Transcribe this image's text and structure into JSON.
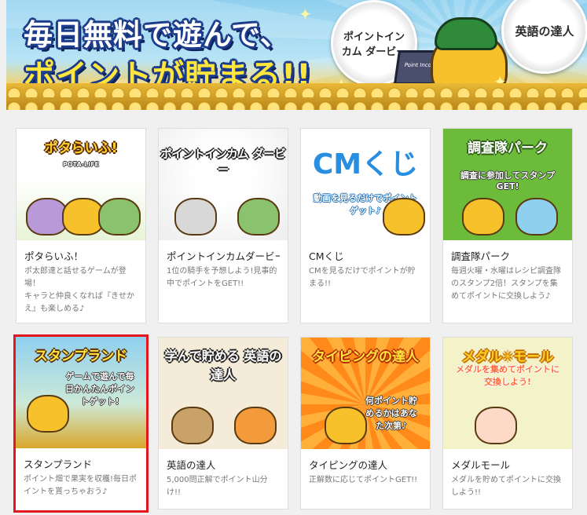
{
  "banner": {
    "headline_line1": "毎日無料で遊んで、",
    "headline_line2": "ポイントが貯まる!!",
    "medal_derby": "ポイントインカム ダービー",
    "medal_eigo": "英語の達人",
    "laptop_logo": "Point Income"
  },
  "games": [
    {
      "title": "ポタらいふ！",
      "thumb_title": "ポタらいふ!",
      "thumb_sub": "POTA-LIFE",
      "description": "ポ太郎達と話せるゲームが登場！\nキャラと仲良くなれば『きせかえ』も楽しめる♪"
    },
    {
      "title": "ポイントインカムダービー",
      "thumb_title": "ポイントインカム ダービー",
      "thumb_sub": "",
      "description": "1位の騎手を予想しよう!見事的中でポイントをGET!!"
    },
    {
      "title": "CMくじ",
      "thumb_title": "CMくじ",
      "thumb_sub": "動画を見るだけでポイントゲット♪",
      "description": "CMを見るだけでポイントが貯まる!!"
    },
    {
      "title": "調査隊パーク",
      "thumb_title": "調査隊パーク",
      "thumb_sub": "調査に参加してスタンプGET!",
      "description": "毎週火曜・水曜はレシピ調査隊のスタンプ2倍！スタンプを集めてポイントに交換しよう♪"
    },
    {
      "title": "スタンプランド",
      "thumb_title": "スタンプランド",
      "thumb_sub": "ゲームで遊んで毎日かんたんポイントゲット!",
      "description": "ポイント畑で果実を収穫!毎日ポイントを貰っちゃおう♪"
    },
    {
      "title": "英語の達人",
      "thumb_title": "学んで貯める 英語の達人",
      "thumb_sub": "",
      "description": "5,000問正解でポイント山分け!!"
    },
    {
      "title": "タイピングの達人",
      "thumb_title": "タイピングの達人",
      "thumb_sub": "何ポイント貯めるかはあなた次第♪",
      "description": "正解数に応じてポイントGET!!"
    },
    {
      "title": "メダルモール",
      "thumb_title": "メダル✳モール",
      "thumb_sub": "メダルを集めてポイントに交換しよう!",
      "description": "メダルを貯めてポイントに交換しよう!!"
    }
  ],
  "colors": {
    "selected_border": "#e4161e",
    "card_title": "#222222",
    "card_desc": "#777777",
    "thumb_bg": [
      "#ffffff",
      "#ffffff",
      "#ffffff",
      "#6dbb3a",
      "#8fd0ef",
      "#f4ecd8",
      "#ff8a1a",
      "#f4f2c8"
    ]
  },
  "selected_index": 4
}
